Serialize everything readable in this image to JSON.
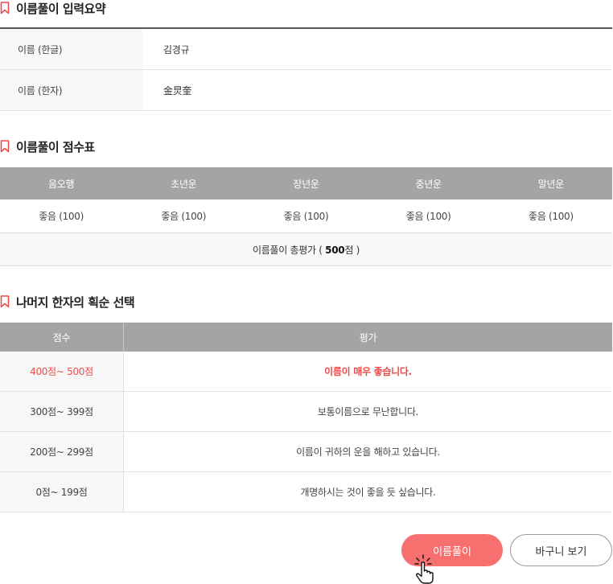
{
  "summary": {
    "title": "이름풀이 입력요약",
    "rows": [
      {
        "label": "이름 (한글)",
        "value": "김경규"
      },
      {
        "label": "이름 (한자)",
        "value": "金炅奎"
      }
    ]
  },
  "score_table": {
    "title": "이름풀이 점수표",
    "headers": [
      "음오행",
      "초년운",
      "장년운",
      "중년운",
      "말년운"
    ],
    "values": [
      "좋음 (100)",
      "좋음 (100)",
      "좋음 (100)",
      "좋음 (100)",
      "좋음 (100)"
    ],
    "total_prefix": "이름풀이 총평가 ( ",
    "total_value": "500",
    "total_suffix": "점 )"
  },
  "strokes_table": {
    "title": "나머지 한자의 획순 선택",
    "headers": [
      "점수",
      "평가"
    ],
    "rows": [
      {
        "range": "400점~ 500점",
        "eval": "이름이 매우 좋습니다."
      },
      {
        "range": "300점~ 399점",
        "eval": "보통이름으로 무난합니다."
      },
      {
        "range": "200점~ 299점",
        "eval": "이름이 귀하의 운을 해하고 있습니다."
      },
      {
        "range": "0점~ 199점",
        "eval": "개명하시는 것이 좋을 듯 싶습니다."
      }
    ]
  },
  "buttons": {
    "name_analysis": "이름풀이",
    "view_cart": "바구니 보기"
  },
  "colors": {
    "accent": "#ee4c4c",
    "button_bg": "#f76f6f",
    "header_bg": "#a4a4a4"
  },
  "icons": {
    "section": "bookmark-icon",
    "cursor": "hand-pointer-icon"
  }
}
